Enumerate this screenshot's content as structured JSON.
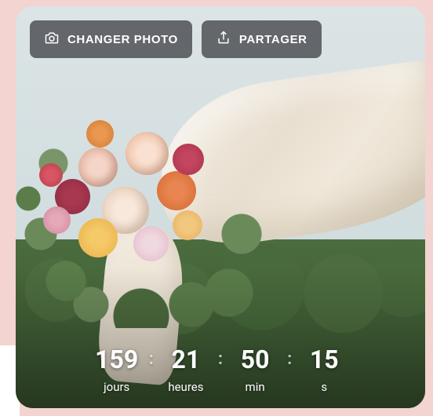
{
  "buttons": {
    "change_photo": "CHANGER PHOTO",
    "share": "PARTAGER"
  },
  "countdown": {
    "days": {
      "value": "159",
      "label": "jours"
    },
    "hours": {
      "value": "21",
      "label": "heures"
    },
    "minutes": {
      "value": "50",
      "label": "min"
    },
    "seconds": {
      "value": "15",
      "label": "s"
    },
    "separator": ":"
  }
}
